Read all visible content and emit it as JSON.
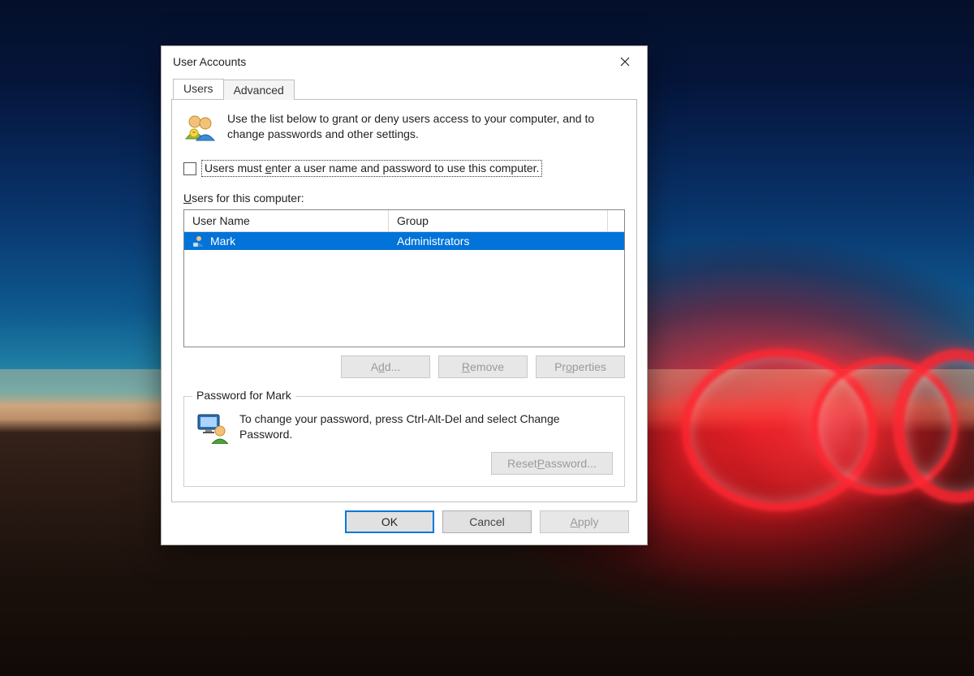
{
  "window": {
    "title": "User Accounts"
  },
  "tabs": {
    "users": "Users",
    "advanced": "Advanced",
    "active": "users"
  },
  "intro": {
    "text": "Use the list below to grant or deny users access to your computer, and to change passwords and other settings."
  },
  "checkbox": {
    "checked": false,
    "label_pre": "Users must ",
    "label_accel": "e",
    "label_post": "nter a user name and password to use this computer."
  },
  "users_list": {
    "label_accel": "U",
    "label_rest": "sers for this computer:",
    "columns": {
      "name": "User Name",
      "group": "Group"
    },
    "rows": [
      {
        "name": "Mark",
        "group": "Administrators",
        "selected": true
      }
    ]
  },
  "buttons": {
    "add_pre": "A",
    "add_accel": "d",
    "add_post": "d...",
    "remove_accel": "R",
    "remove_rest": "emove",
    "properties_pre": "Pr",
    "properties_accel": "o",
    "properties_post": "perties"
  },
  "password_group": {
    "legend": "Password for Mark",
    "text": "To change your password, press Ctrl-Alt-Del and select Change Password.",
    "reset_pre": "Reset ",
    "reset_accel": "P",
    "reset_post": "assword..."
  },
  "dialog_buttons": {
    "ok": "OK",
    "cancel": "Cancel",
    "apply_accel": "A",
    "apply_rest": "pply"
  }
}
